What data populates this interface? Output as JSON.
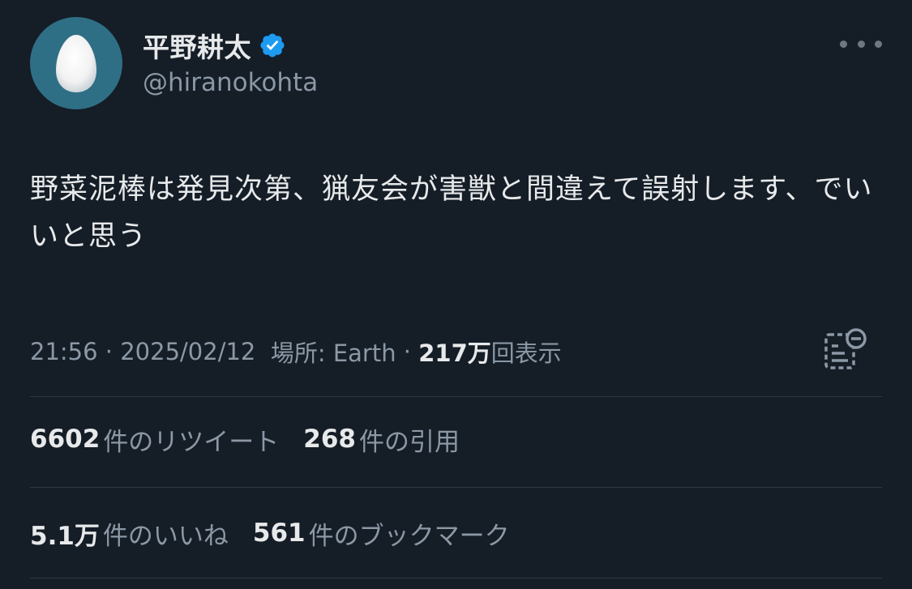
{
  "user": {
    "display_name": "平野耕太",
    "handle": "@hiranokohta",
    "verified_icon": "verified-badge-icon",
    "accent_color": "#1d9bf0"
  },
  "tweet": {
    "text": "野菜泥棒は発見次第、猟友会が害獣と間違えて誤射します、でいいと思う"
  },
  "meta": {
    "time": "21:56",
    "separator": " · ",
    "date": "2025/02/12",
    "location": "場所: Earth",
    "views_count": "217万",
    "views_label": "回表示"
  },
  "stats": {
    "retweets_count": "6602",
    "retweets_label": "件のリツイート",
    "quotes_count": "268",
    "quotes_label": "件の引用",
    "likes_count": "5.1万",
    "likes_label": "件のいいね",
    "bookmarks_count": "561",
    "bookmarks_label": "件のブックマーク"
  },
  "colors": {
    "background": "#151d27",
    "primary_text": "#e7e9ea",
    "secondary_text": "#8b98a5",
    "avatar_bg": "#2f6f85"
  }
}
